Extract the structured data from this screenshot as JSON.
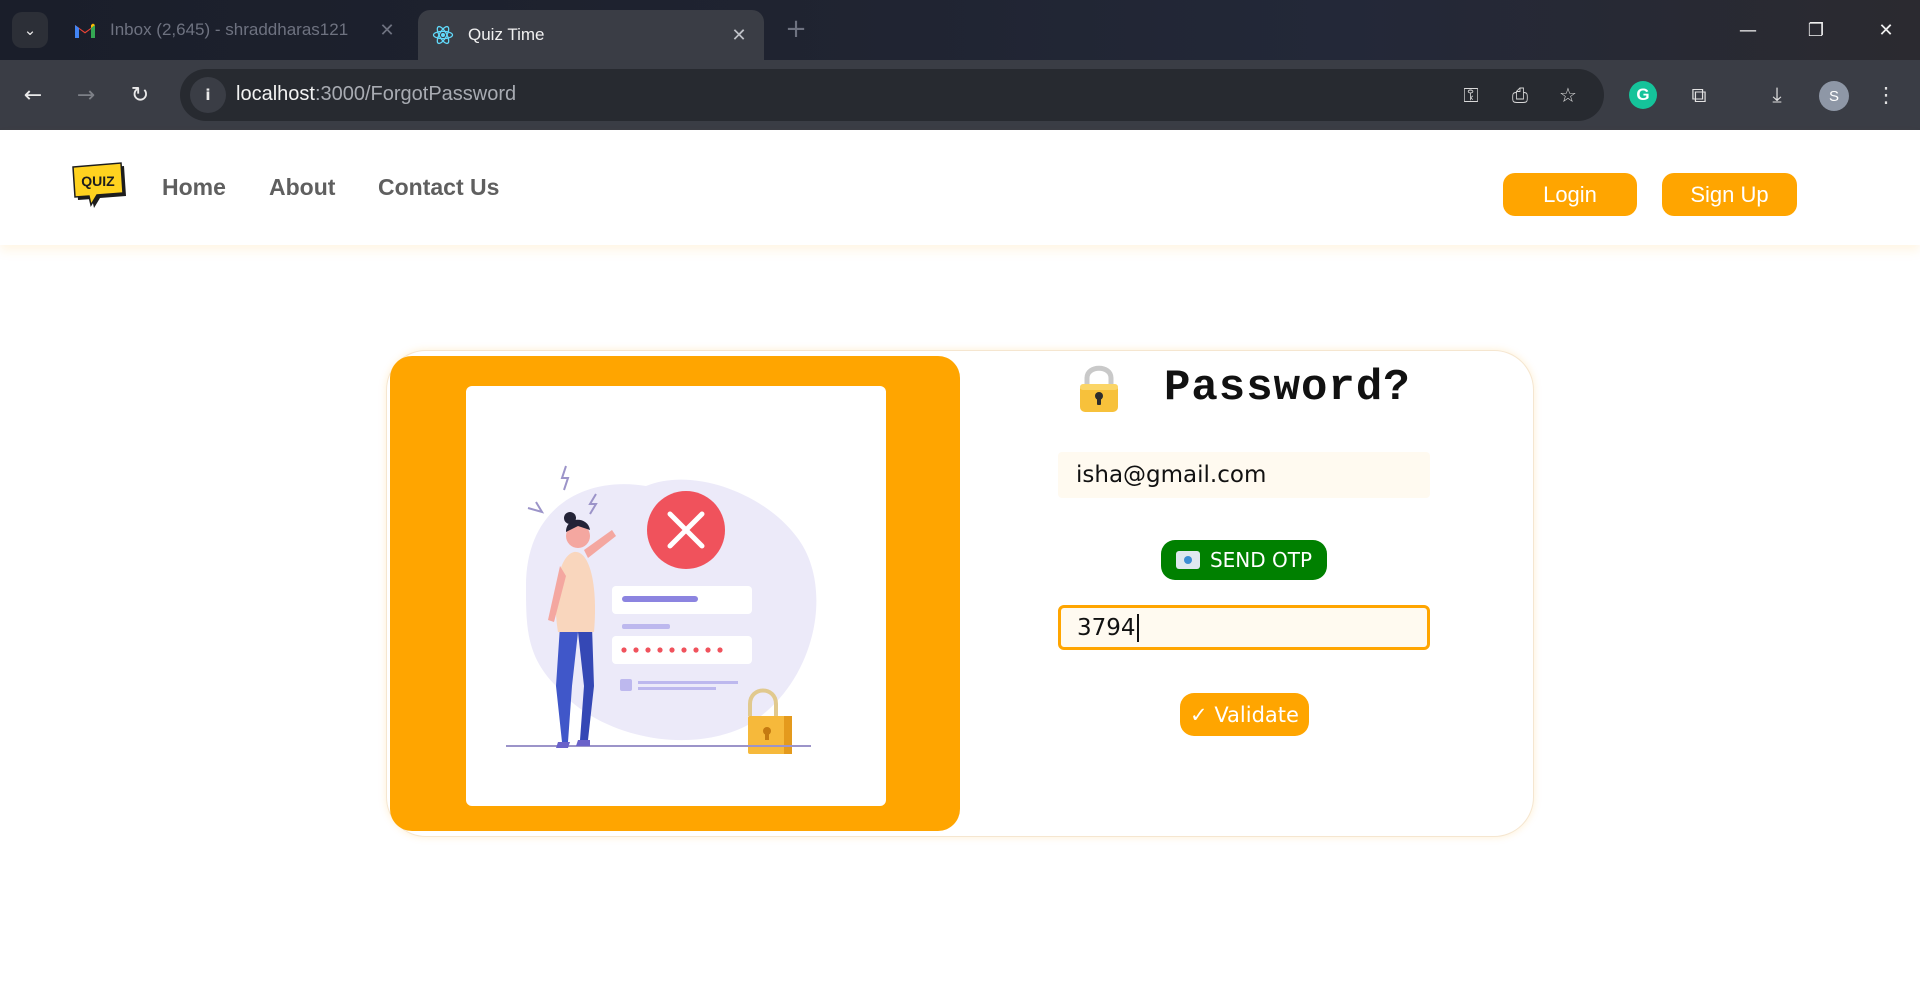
{
  "browser": {
    "tabs": [
      {
        "title": "Inbox (2,645) - shraddharas121",
        "favicon": "gmail-icon",
        "active": false
      },
      {
        "title": "Quiz Time",
        "favicon": "react-icon",
        "active": true
      }
    ],
    "url_host": "localhost",
    "url_path": ":3000/ForgotPassword",
    "profile_initial": "S",
    "extension_badge": "G"
  },
  "header": {
    "logo_text": "QUIZ",
    "nav": [
      {
        "label": "Home"
      },
      {
        "label": "About"
      },
      {
        "label": "Contact Us"
      }
    ],
    "login_label": "Login",
    "signup_label": "Sign Up"
  },
  "form": {
    "heading": "Password?",
    "heading_icon": "lock-icon",
    "email_value": "isha@gmail.com",
    "send_otp_label": "SEND OTP",
    "send_otp_icon": "envelope-icon",
    "otp_value": "3794",
    "validate_label": "✓ Validate"
  },
  "colors": {
    "accent": "#ffa500",
    "send_otp": "#008000",
    "input_bg": "#fffaf0",
    "nav_text": "#5f5f5f"
  }
}
